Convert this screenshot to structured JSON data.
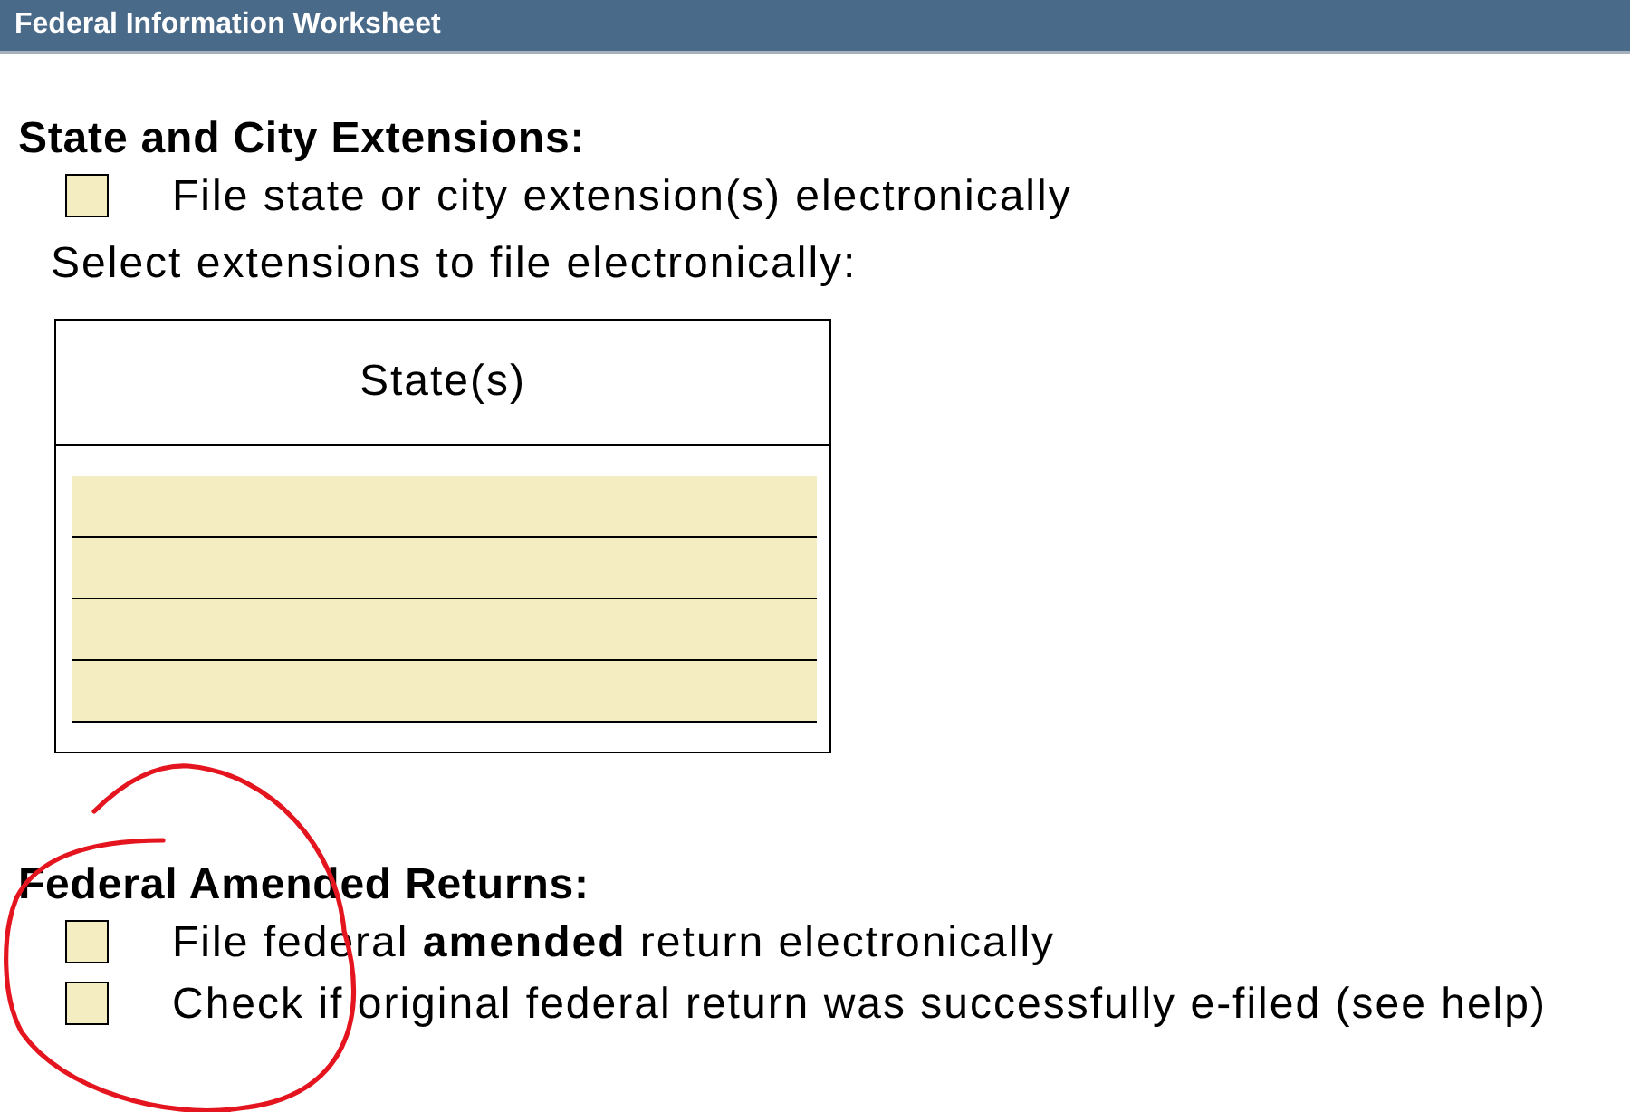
{
  "window": {
    "title": "Federal Information Worksheet"
  },
  "sections": [
    {
      "heading": "State and City Extensions:",
      "options": [
        {
          "label": "File state or city extension(s) electronically",
          "checked": false
        }
      ],
      "instruction": "Select extensions to file electronically:",
      "table": {
        "columns": [
          "State(s)"
        ],
        "rows": [
          {
            "kind": "input"
          },
          {
            "kind": "input"
          },
          {
            "kind": "input"
          },
          {
            "kind": "input"
          }
        ]
      }
    },
    {
      "heading": "Federal Amended Returns:",
      "options": [
        {
          "label": "File federal **amended** return electronically",
          "checked": false
        },
        {
          "label": "Check if original federal return was successfully e-filed (see help)",
          "checked": false
        }
      ]
    }
  ],
  "annotations": [
    {
      "kind": "freehand-circle"
    }
  ]
}
